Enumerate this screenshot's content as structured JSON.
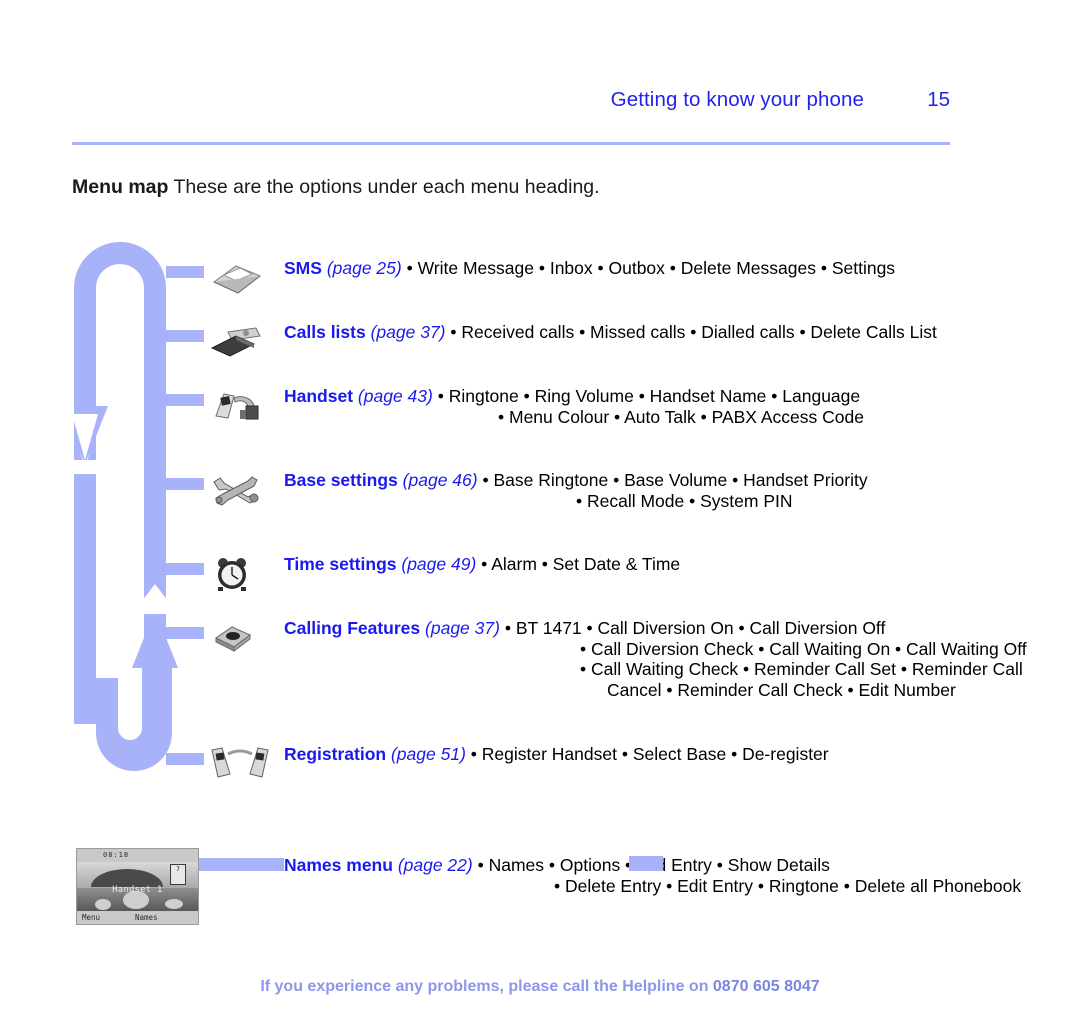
{
  "header": {
    "title": "Getting to know your phone",
    "page_number": "15"
  },
  "intro": {
    "label": "Menu map",
    "text": "These are the options under each menu heading."
  },
  "menu_rows": [
    {
      "id": "sms",
      "icon": "envelope-icon",
      "heading": "SMS",
      "page_ref": "(page 25)",
      "lines": [
        "• Write Message  • Inbox  • Outbox  • Delete Messages  • Settings"
      ]
    },
    {
      "id": "calls-lists",
      "icon": "calls-list-icon",
      "heading": "Calls lists",
      "page_ref": "(page 37)",
      "lines": [
        "• Received calls  • Missed calls  • Dialled calls  • Delete Calls List"
      ]
    },
    {
      "id": "handset",
      "icon": "handset-icon",
      "heading": "Handset",
      "page_ref": "(page 43)",
      "lines": [
        "• Ringtone  • Ring Volume  • Handset Name  • Language",
        "• Menu Colour  • Auto Talk  • PABX Access Code"
      ]
    },
    {
      "id": "base-settings",
      "icon": "spanner-icon",
      "heading": "Base settings",
      "page_ref": "(page 46)",
      "lines": [
        "• Base Ringtone  • Base Volume  • Handset Priority",
        "• Recall Mode  • System PIN"
      ]
    },
    {
      "id": "time-settings",
      "icon": "alarm-clock-icon",
      "heading": "Time settings",
      "page_ref": "(page 49)",
      "lines": [
        "• Alarm  • Set Date & Time"
      ]
    },
    {
      "id": "calling-features",
      "icon": "call-features-icon",
      "heading": "Calling Features",
      "page_ref": "(page 37)",
      "lines": [
        "• BT 1471  • Call Diversion On  • Call Diversion Off",
        "• Call Diversion Check  • Call Waiting On  • Call Waiting Off",
        "• Call Waiting Check  • Reminder Call Set  • Reminder Call",
        "Cancel  • Reminder Call Check  • Edit Number"
      ]
    },
    {
      "id": "registration",
      "icon": "two-handsets-icon",
      "heading": "Registration",
      "page_ref": "(page 51)",
      "lines": [
        "• Register Handset  • Select Base  • De-register"
      ]
    },
    {
      "id": "names-menu",
      "icon": "phone-screen-thumbnail",
      "heading": "Names menu",
      "page_ref": "(page 22)",
      "lines": [
        "• Names  • Options  • Add Entry  • Show Details",
        "• Delete Entry  • Edit Entry  • Ringtone  • Delete all Phonebook"
      ]
    }
  ],
  "phone_screen": {
    "status_time": "08:18",
    "handset_label": "Handset 1",
    "softkey_left": "Menu",
    "softkey_right": "Names",
    "battery_glyph": "7"
  },
  "footer": {
    "text": "If you experience any problems, please call the Helpline on ",
    "phone": "0870 605 8047"
  },
  "colors": {
    "heading_blue": "#1a1aee",
    "accent_light": "#a8b2f8",
    "footer_blue": "#8d97e8"
  }
}
